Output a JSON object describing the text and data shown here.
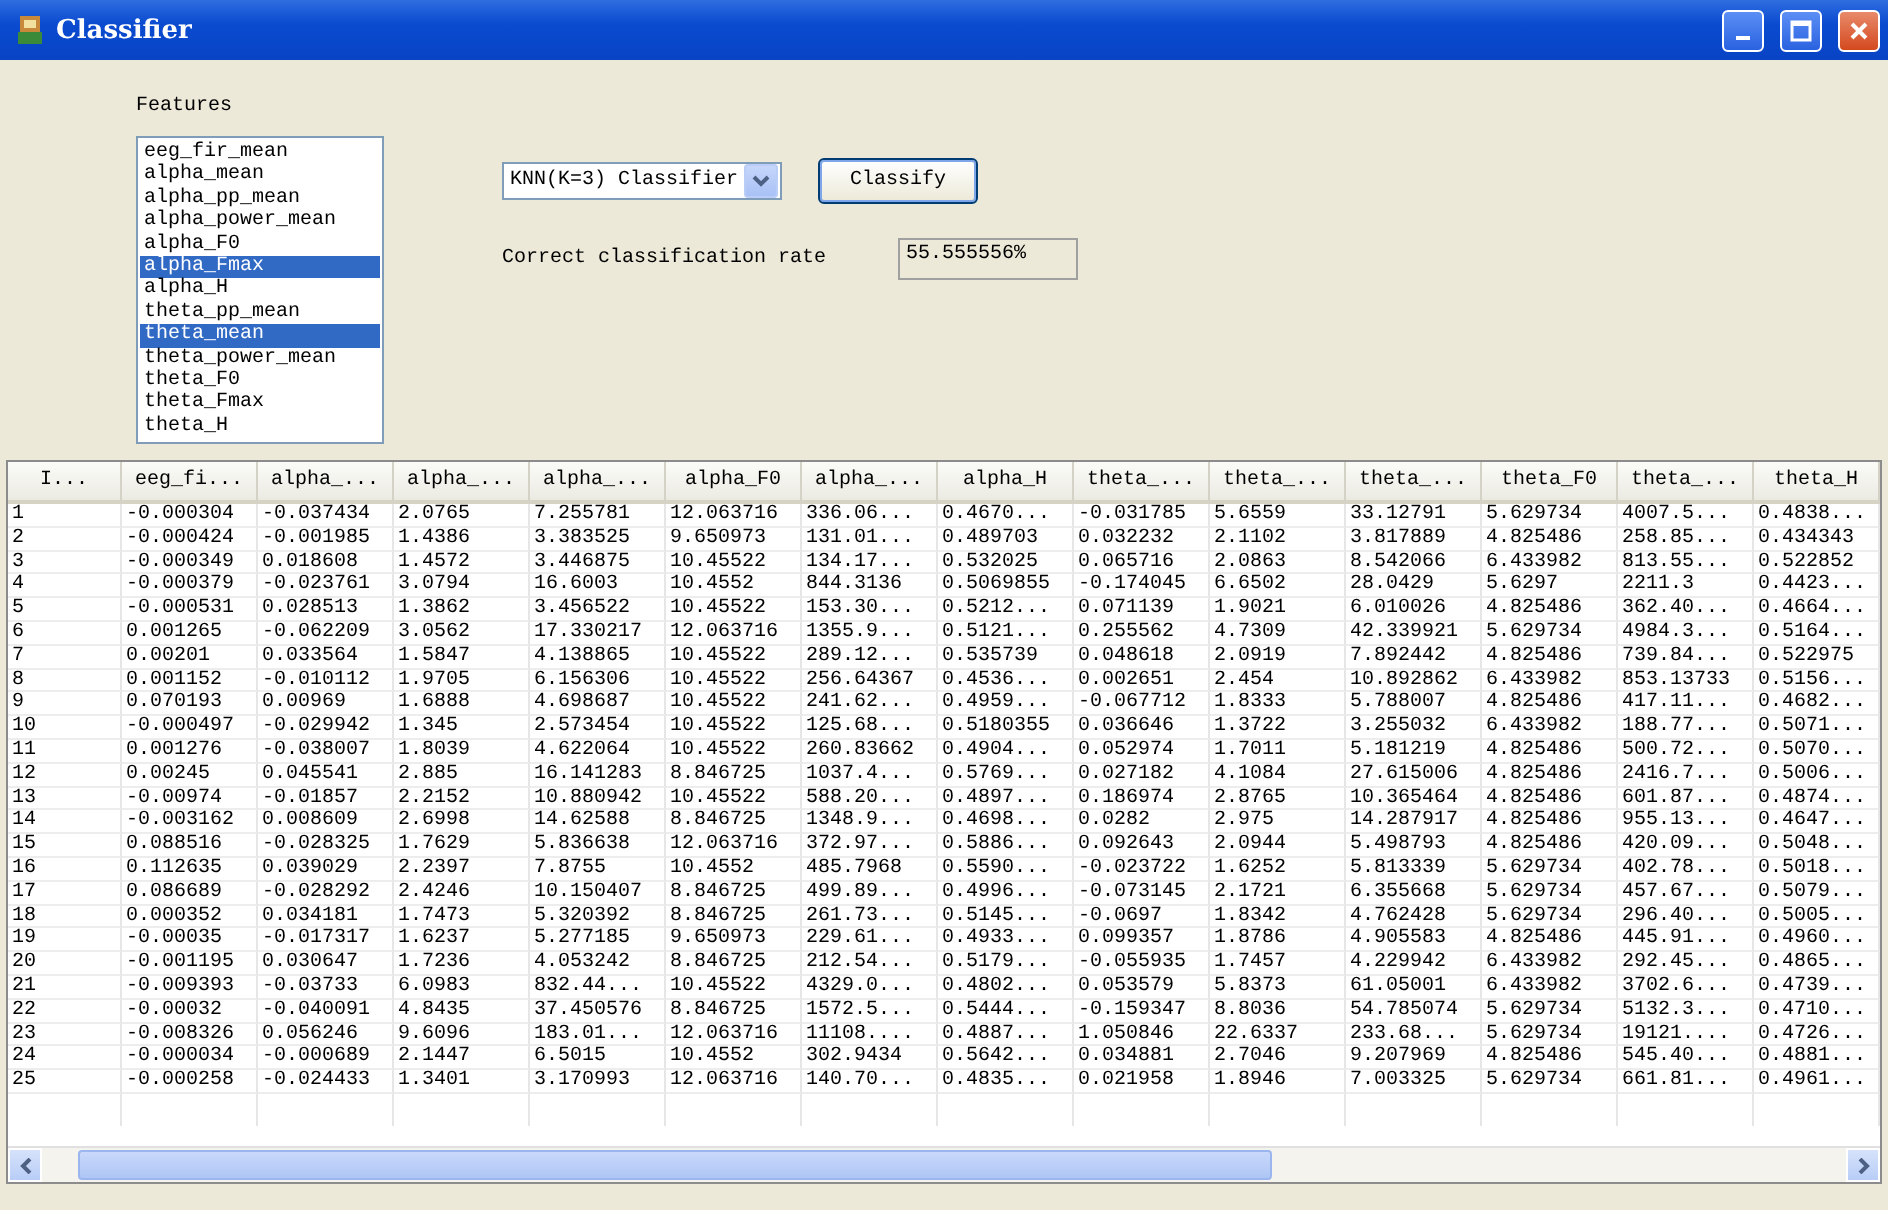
{
  "window": {
    "title": "Classifier"
  },
  "features": {
    "label": "Features",
    "items": [
      {
        "label": "eeg_fir_mean",
        "selected": false
      },
      {
        "label": "alpha_mean",
        "selected": false
      },
      {
        "label": "alpha_pp_mean",
        "selected": false
      },
      {
        "label": "alpha_power_mean",
        "selected": false
      },
      {
        "label": "alpha_F0",
        "selected": false
      },
      {
        "label": "alpha_Fmax",
        "selected": true
      },
      {
        "label": "alpha_H",
        "selected": false
      },
      {
        "label": "theta_pp_mean",
        "selected": false
      },
      {
        "label": "theta_mean",
        "selected": true
      },
      {
        "label": "theta_power_mean",
        "selected": false
      },
      {
        "label": "theta_F0",
        "selected": false
      },
      {
        "label": "theta_Fmax",
        "selected": false
      },
      {
        "label": "theta_H",
        "selected": false
      }
    ]
  },
  "classifier_dropdown": {
    "value": "KNN(K=3) Classifier"
  },
  "classify_button": "Classify",
  "rate": {
    "label": "Correct classification rate",
    "value": "55.555556%"
  },
  "table": {
    "columns": [
      "I...",
      "eeg_fi...",
      "alpha_...",
      "alpha_...",
      "alpha_...",
      "alpha_F0",
      "alpha_...",
      "alpha_H",
      "theta_...",
      "theta_...",
      "theta_...",
      "theta_F0",
      "theta_...",
      "theta_H"
    ],
    "rows": [
      [
        "1",
        "-0.000304",
        "-0.037434",
        "2.0765",
        "7.255781",
        "12.063716",
        "336.06...",
        "0.4670...",
        "-0.031785",
        "5.6559",
        "33.12791",
        "5.629734",
        "4007.5...",
        "0.4838..."
      ],
      [
        "2",
        "-0.000424",
        "-0.001985",
        "1.4386",
        "3.383525",
        "9.650973",
        "131.01...",
        "0.489703",
        "0.032232",
        "2.1102",
        "3.817889",
        "4.825486",
        "258.85...",
        "0.434343"
      ],
      [
        "3",
        "-0.000349",
        "0.018608",
        "1.4572",
        "3.446875",
        "10.45522",
        "134.17...",
        "0.532025",
        "0.065716",
        "2.0863",
        "8.542066",
        "6.433982",
        "813.55...",
        "0.522852"
      ],
      [
        "4",
        "-0.000379",
        "-0.023761",
        "3.0794",
        "16.6003",
        "10.4552",
        "844.3136",
        "0.5069855",
        "-0.174045",
        "6.6502",
        "28.0429",
        "5.6297",
        "2211.3",
        "0.4423..."
      ],
      [
        "5",
        "-0.000531",
        "0.028513",
        "1.3862",
        "3.456522",
        "10.45522",
        "153.30...",
        "0.5212...",
        "0.071139",
        "1.9021",
        "6.010026",
        "4.825486",
        "362.40...",
        "0.4664..."
      ],
      [
        "6",
        "0.001265",
        "-0.062209",
        "3.0562",
        "17.330217",
        "12.063716",
        "1355.9...",
        "0.5121...",
        "0.255562",
        "4.7309",
        "42.339921",
        "5.629734",
        "4984.3...",
        "0.5164..."
      ],
      [
        "7",
        "0.00201",
        "0.033564",
        "1.5847",
        "4.138865",
        "10.45522",
        "289.12...",
        "0.535739",
        "0.048618",
        "2.0919",
        "7.892442",
        "4.825486",
        "739.84...",
        "0.522975"
      ],
      [
        "8",
        "0.001152",
        "-0.010112",
        "1.9705",
        "6.156306",
        "10.45522",
        "256.64367",
        "0.4536...",
        "0.002651",
        "2.454",
        "10.892862",
        "6.433982",
        "853.13733",
        "0.5156..."
      ],
      [
        "9",
        "0.070193",
        "0.00969",
        "1.6888",
        "4.698687",
        "10.45522",
        "241.62...",
        "0.4959...",
        "-0.067712",
        "1.8333",
        "5.788007",
        "4.825486",
        "417.11...",
        "0.4682..."
      ],
      [
        "10",
        "-0.000497",
        "-0.029942",
        "1.345",
        "2.573454",
        "10.45522",
        "125.68...",
        "0.5180355",
        "0.036646",
        "1.3722",
        "3.255032",
        "6.433982",
        "188.77...",
        "0.5071..."
      ],
      [
        "11",
        "0.001276",
        "-0.038007",
        "1.8039",
        "4.622064",
        "10.45522",
        "260.83662",
        "0.4904...",
        "0.052974",
        "1.7011",
        "5.181219",
        "4.825486",
        "500.72...",
        "0.5070..."
      ],
      [
        "12",
        "0.00245",
        "0.045541",
        "2.885",
        "16.141283",
        "8.846725",
        "1037.4...",
        "0.5769...",
        "0.027182",
        "4.1084",
        "27.615006",
        "4.825486",
        "2416.7...",
        "0.5006..."
      ],
      [
        "13",
        "-0.00974",
        "-0.01857",
        "2.2152",
        "10.880942",
        "10.45522",
        "588.20...",
        "0.4897...",
        "0.186974",
        "2.8765",
        "10.365464",
        "4.825486",
        "601.87...",
        "0.4874..."
      ],
      [
        "14",
        "-0.003162",
        "0.008609",
        "2.6998",
        "14.62588",
        "8.846725",
        "1348.9...",
        "0.4698...",
        "0.0282",
        "2.975",
        "14.287917",
        "4.825486",
        "955.13...",
        "0.4647..."
      ],
      [
        "15",
        "0.088516",
        "-0.028325",
        "1.7629",
        "5.836638",
        "12.063716",
        "372.97...",
        "0.5886...",
        "0.092643",
        "2.0944",
        "5.498793",
        "4.825486",
        "420.09...",
        "0.5048..."
      ],
      [
        "16",
        "0.112635",
        "0.039029",
        "2.2397",
        "7.8755",
        "10.4552",
        "485.7968",
        "0.5590...",
        "-0.023722",
        "1.6252",
        "5.813339",
        "5.629734",
        "402.78...",
        "0.5018..."
      ],
      [
        "17",
        "0.086689",
        "-0.028292",
        "2.4246",
        "10.150407",
        "8.846725",
        "499.89...",
        "0.4996...",
        "-0.073145",
        "2.1721",
        "6.355668",
        "5.629734",
        "457.67...",
        "0.5079..."
      ],
      [
        "18",
        "0.000352",
        "0.034181",
        "1.7473",
        "5.320392",
        "8.846725",
        "261.73...",
        "0.5145...",
        "-0.0697",
        "1.8342",
        "4.762428",
        "5.629734",
        "296.40...",
        "0.5005..."
      ],
      [
        "19",
        "-0.00035",
        "-0.017317",
        "1.6237",
        "5.277185",
        "9.650973",
        "229.61...",
        "0.4933...",
        "0.099357",
        "1.8786",
        "4.905583",
        "4.825486",
        "445.91...",
        "0.4960..."
      ],
      [
        "20",
        "-0.001195",
        "0.030647",
        "1.7236",
        "4.053242",
        "8.846725",
        "212.54...",
        "0.5179...",
        "-0.055935",
        "1.7457",
        "4.229942",
        "6.433982",
        "292.45...",
        "0.4865..."
      ],
      [
        "21",
        "-0.009393",
        "-0.03733",
        "6.0983",
        "832.44...",
        "10.45522",
        "4329.0...",
        "0.4802...",
        "0.053579",
        "5.8373",
        "61.05001",
        "6.433982",
        "3702.6...",
        "0.4739..."
      ],
      [
        "22",
        "-0.00032",
        "-0.040091",
        "4.8435",
        "37.450576",
        "8.846725",
        "1572.5...",
        "0.5444...",
        "-0.159347",
        "8.8036",
        "54.785074",
        "5.629734",
        "5132.3...",
        "0.4710..."
      ],
      [
        "23",
        "-0.008326",
        "0.056246",
        "9.6096",
        "183.01...",
        "12.063716",
        "11108....",
        "0.4887...",
        "1.050846",
        "22.6337",
        "233.68...",
        "5.629734",
        "19121....",
        "0.4726..."
      ],
      [
        "24",
        "-0.000034",
        "-0.000689",
        "2.1447",
        "6.5015",
        "10.4552",
        "302.9434",
        "0.5642...",
        "0.034881",
        "2.7046",
        "9.207969",
        "4.825486",
        "545.40...",
        "0.4881..."
      ],
      [
        "25",
        "-0.000258",
        "-0.024433",
        "1.3401",
        "3.170993",
        "12.063716",
        "140.70...",
        "0.4835...",
        "0.021958",
        "1.8946",
        "7.003325",
        "5.629734",
        "661.81...",
        "0.4961..."
      ]
    ]
  }
}
